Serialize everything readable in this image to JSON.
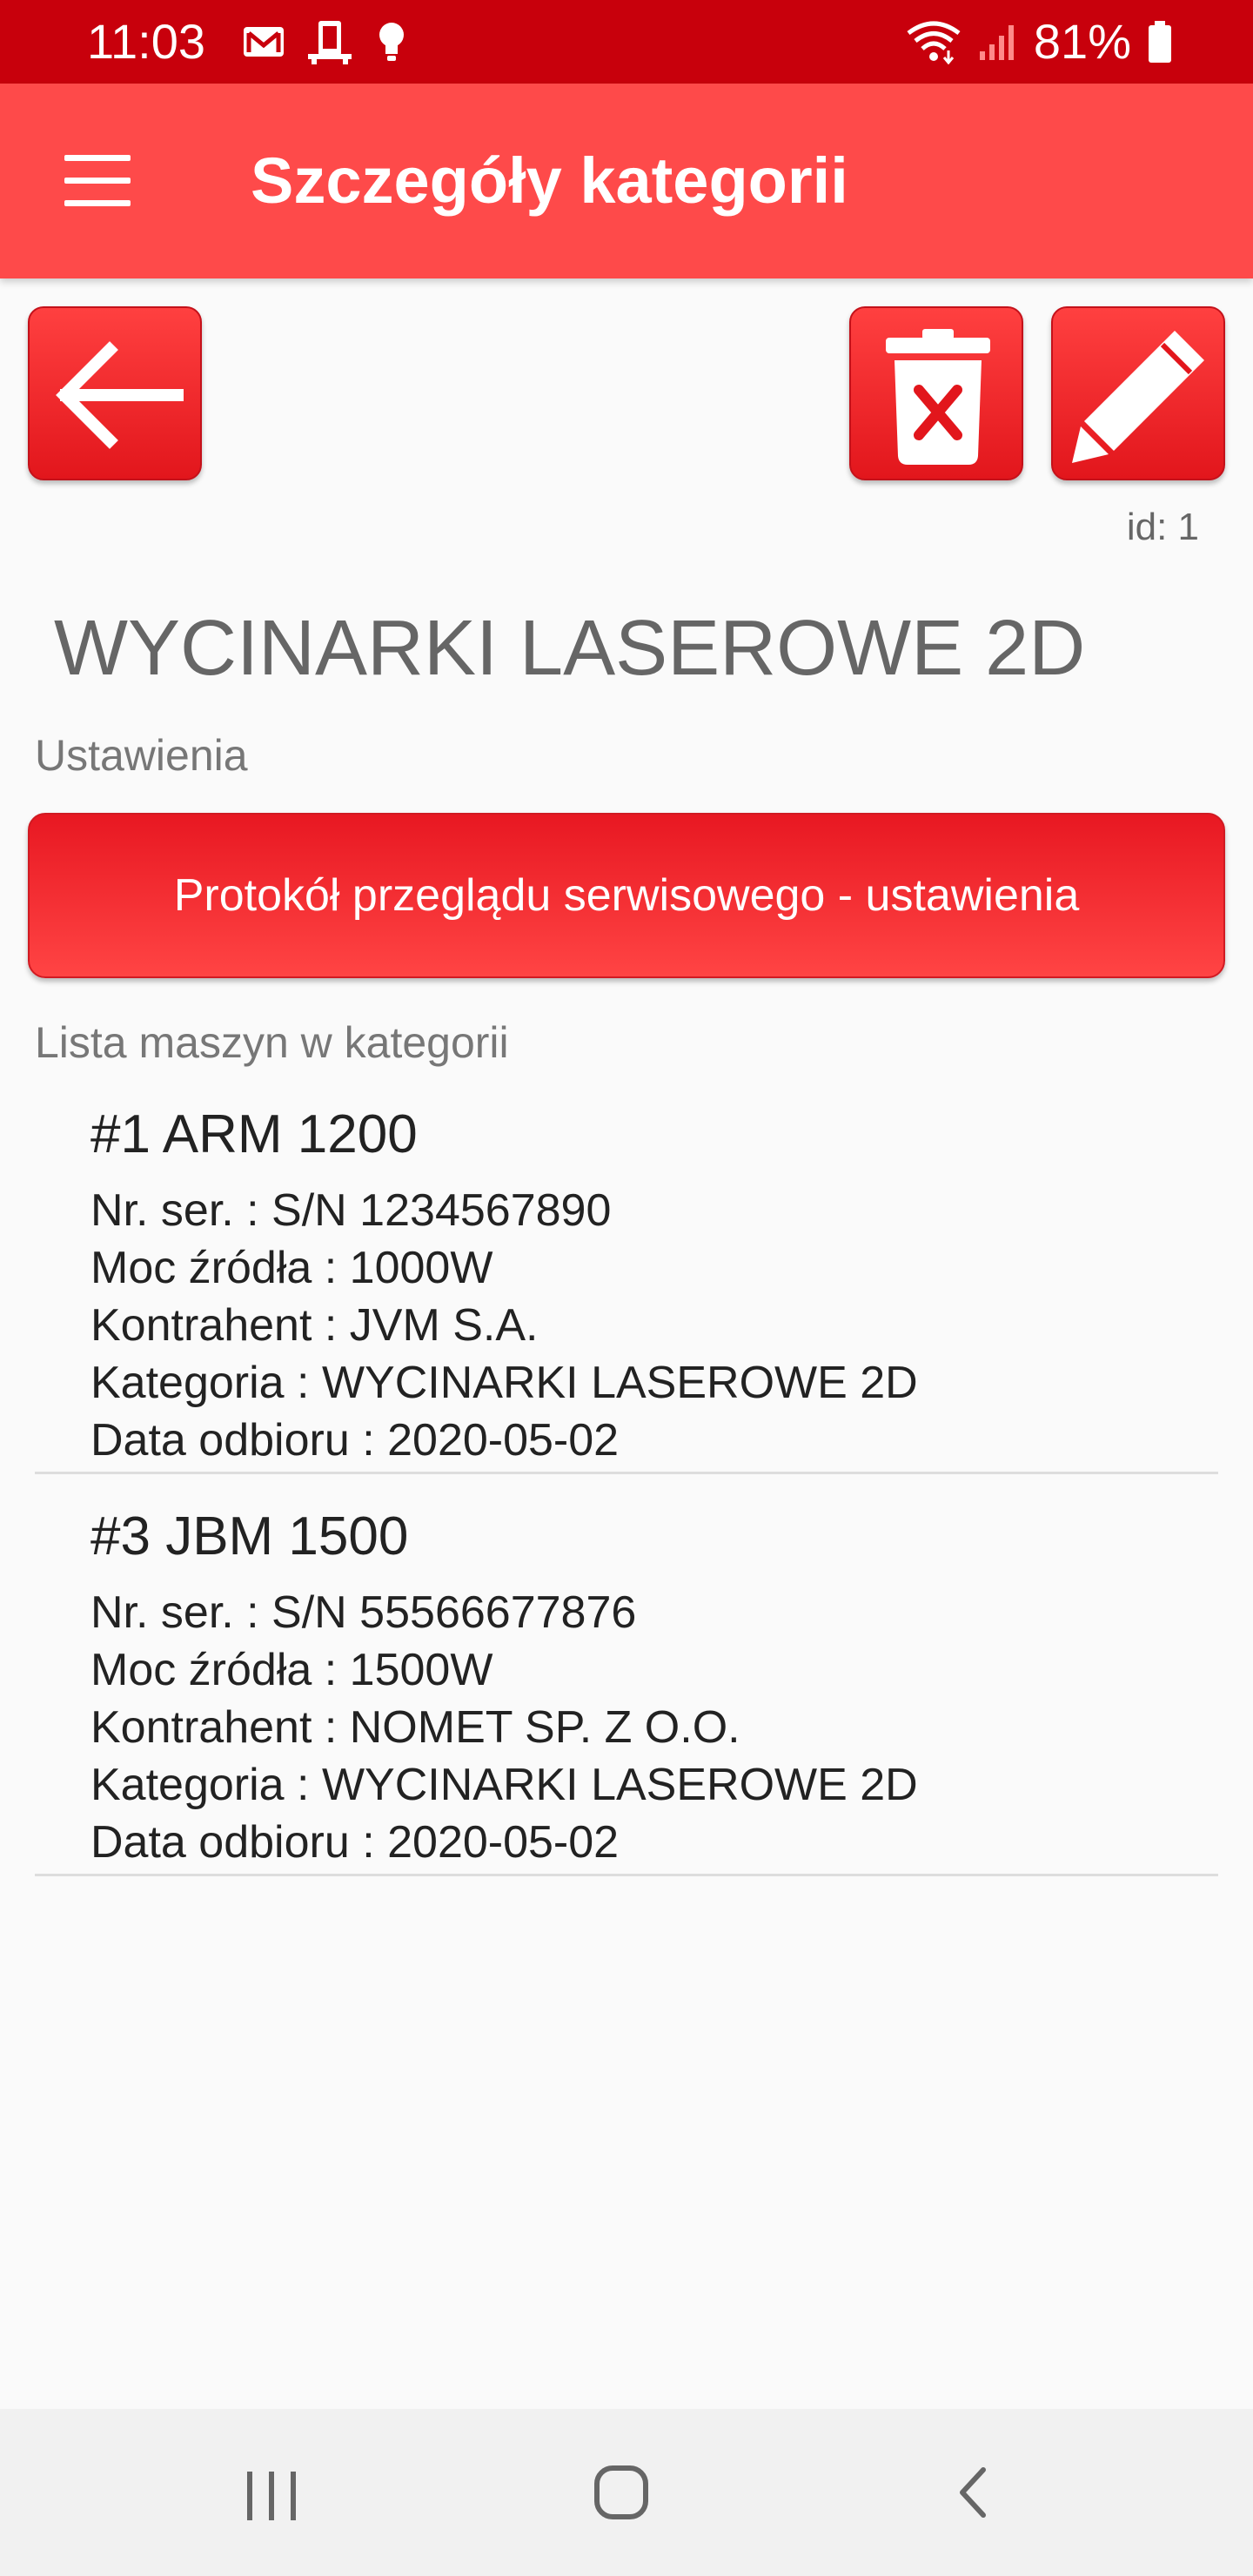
{
  "status_bar": {
    "time": "11:03",
    "battery": "81%",
    "icons": [
      "gmail-icon",
      "device-icon",
      "bulb-icon",
      "wifi-icon",
      "signal-icon",
      "battery-icon"
    ]
  },
  "app_bar": {
    "title": "Szczegóły kategorii",
    "menu_icon": "hamburger-menu-icon"
  },
  "actions": {
    "back_icon": "arrow-left-icon",
    "delete_icon": "trash-delete-icon",
    "edit_icon": "pencil-edit-icon"
  },
  "category": {
    "id_label": "id: 1",
    "name": "WYCINARKI LASEROWE 2D"
  },
  "settings": {
    "section_label": "Ustawienia",
    "protocol_button_label": "Protokół przeglądu serwisowego - ustawienia"
  },
  "machines": {
    "section_label": "Lista maszyn w kategorii",
    "items": [
      {
        "title": "#1 ARM 1200",
        "serial": "Nr. ser. : S/N 1234567890",
        "power": "Moc źródła : 1000W",
        "contractor": "Kontrahent : JVM S.A.",
        "category": "Kategoria : WYCINARKI LASEROWE 2D",
        "date": "Data odbioru : 2020-05-02"
      },
      {
        "title": "#3 JBM 1500",
        "serial": "Nr. ser. : S/N 55566677876",
        "power": "Moc źródła : 1500W",
        "contractor": "Kontrahent : NOMET SP. Z O.O.",
        "category": "Kategoria : WYCINARKI LASEROWE 2D",
        "date": "Data odbioru : 2020-05-02"
      }
    ]
  },
  "colors": {
    "status_bar": "#c8000c",
    "app_bar": "#fe4a4a",
    "button_red": "#e2161c",
    "background": "#fafafa"
  }
}
